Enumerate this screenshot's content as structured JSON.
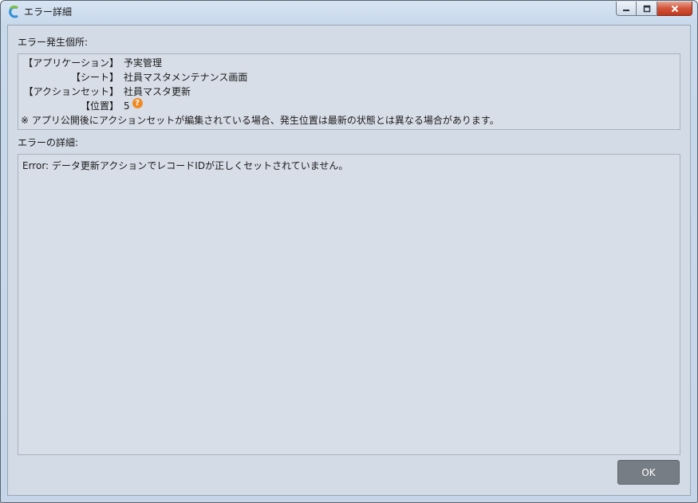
{
  "window": {
    "title": "エラー詳細",
    "icon": "app-logo-icon",
    "controls": [
      "minimize-icon",
      "maximize-icon",
      "close-icon"
    ]
  },
  "location": {
    "heading": "エラー発生個所:",
    "rows": [
      {
        "key": "【アプリケーション】",
        "value": "予実管理"
      },
      {
        "key": "【シート】",
        "value": "社員マスタメンテナンス画面"
      },
      {
        "key": "【アクションセット】",
        "value": "社員マスタ更新"
      },
      {
        "key": "【位置】",
        "value": "5"
      }
    ],
    "help_icon": "question-icon",
    "note": "※ アプリ公開後にアクションセットが編集されている場合、発生位置は最新の状態とは異なる場合があります。"
  },
  "detail": {
    "heading": "エラーの詳細:",
    "text": "Error: データ更新アクションでレコードIDが正しくセットされていません。"
  },
  "footer": {
    "ok_label": "OK"
  },
  "colors": {
    "ok_button_bg": "#777d84",
    "help_icon": "#f08a24",
    "close_button": "#c1381c"
  }
}
